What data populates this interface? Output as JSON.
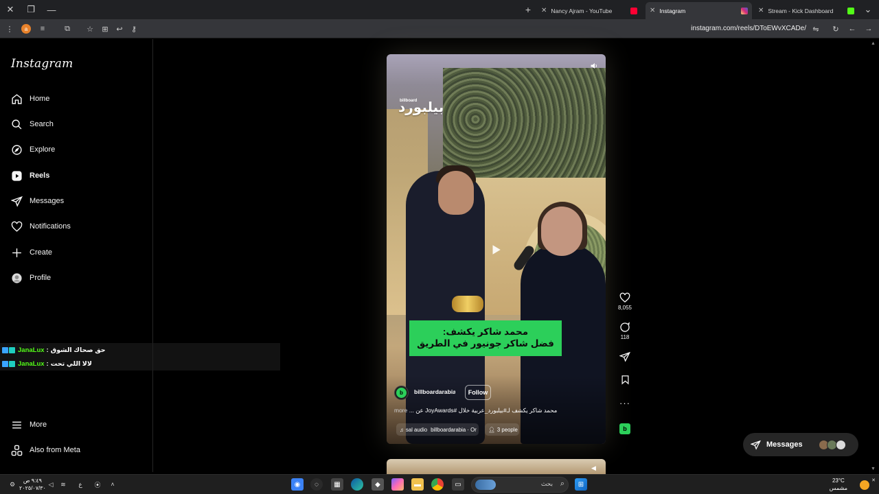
{
  "browser": {
    "tabs": [
      {
        "label": "Nancy Ajram - YouTube",
        "favicon_color": "#ff0033",
        "active": false
      },
      {
        "label": "Instagram",
        "favicon_color": "#d6249f",
        "active": true
      },
      {
        "label": "Stream - Kick Dashboard",
        "favicon_color": "#53fc18",
        "active": false
      }
    ],
    "url": "instagram.com/reels/DToEWvXCADe/",
    "profile_initial": "a"
  },
  "sidebar": {
    "logo": "Instagram",
    "items": [
      {
        "label": "Home",
        "icon": "home-icon"
      },
      {
        "label": "Search",
        "icon": "search-icon"
      },
      {
        "label": "Explore",
        "icon": "explore-icon"
      },
      {
        "label": "Reels",
        "icon": "reels-icon"
      },
      {
        "label": "Messages",
        "icon": "messages-icon"
      },
      {
        "label": "Notifications",
        "icon": "heart-icon"
      },
      {
        "label": "Create",
        "icon": "plus-icon"
      },
      {
        "label": "Profile",
        "icon": "profile-icon"
      }
    ],
    "more": "More",
    "also_from_meta": "Also from Meta"
  },
  "chat_overlay": [
    {
      "user": "JanaLux",
      "separator": ":",
      "message": "حق صحاك الشوق"
    },
    {
      "user": "JanaLux",
      "separator": ":",
      "message": "لالا اللي تحت"
    }
  ],
  "reel": {
    "brand_small": "billboard",
    "brand_logo": "بيلبورد",
    "caption_line1": "محمد شاكر يكشف:",
    "caption_line2": "فضل شاكر جونيور في الطريق",
    "account": "billboardarabia",
    "follow": "Follow",
    "description": "محمد شاكر يكشف لـ#بيلبورد_عربية خلال #JoyAwards عن ...",
    "more": "more",
    "audio": "sal audio",
    "audio_source": "billboardarabia · Or",
    "people": "3 people"
  },
  "actions": {
    "likes": "8,055",
    "comments": "118"
  },
  "messages_pill": {
    "label": "Messages"
  },
  "taskbar": {
    "search_placeholder": "بحث",
    "time": "٩:٤٩ ص",
    "date": "٢٠٢٥/٠٧/٣٠",
    "temperature": "23°C",
    "weather": "مشمس",
    "lang": "ع"
  },
  "colors": {
    "accent_green": "#2ccf5a",
    "kick_green": "#53fc18",
    "background": "#000000"
  }
}
